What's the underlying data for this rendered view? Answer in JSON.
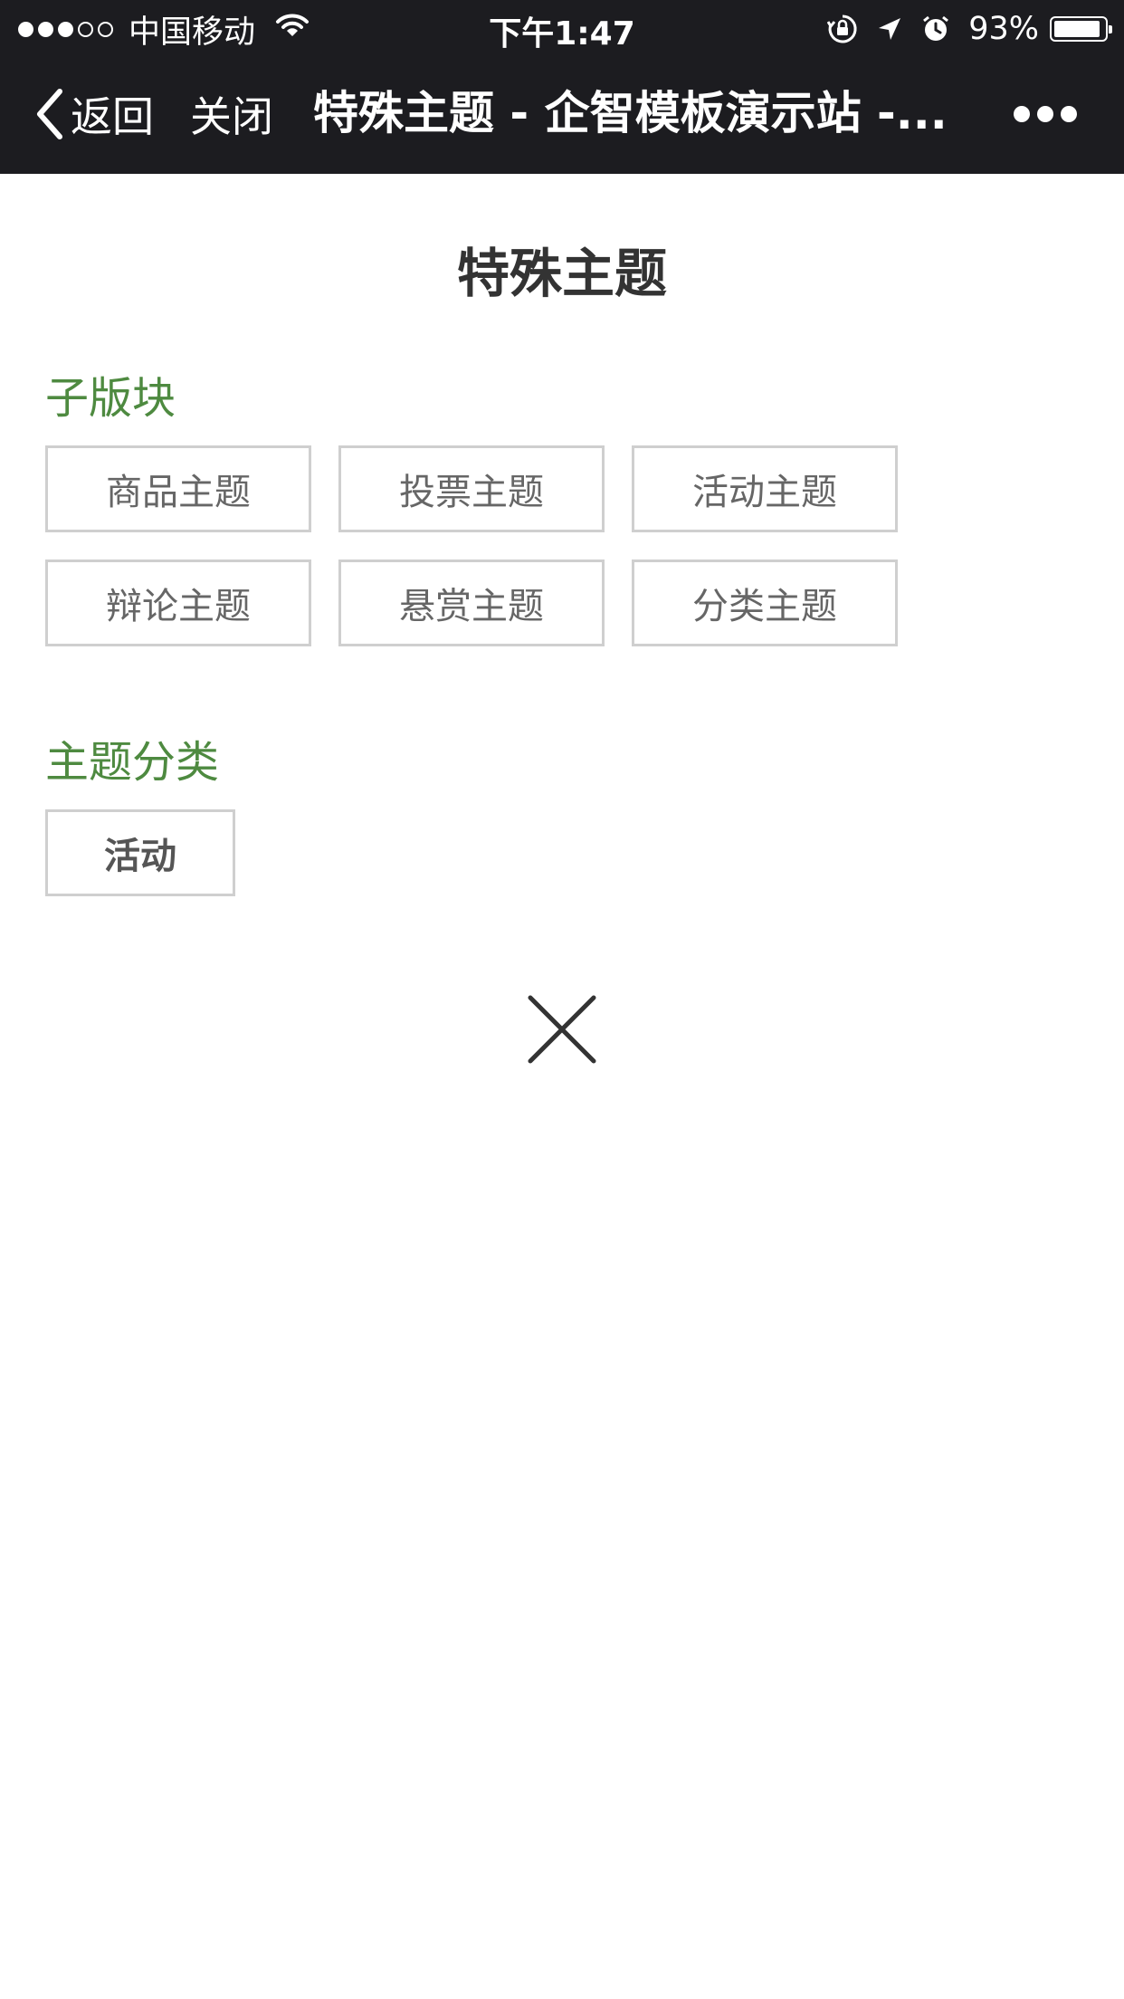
{
  "status_bar": {
    "carrier": "中国移动",
    "time": "下午1:47",
    "battery_percent": "93%",
    "battery_level": 0.93,
    "signal_strength": 3,
    "signal_total": 5
  },
  "nav": {
    "back_label": "返回",
    "close_label": "关闭",
    "title": "特殊主题 - 企智模板演示站 -..."
  },
  "page": {
    "title": "特殊主题"
  },
  "subforums": {
    "heading": "子版块",
    "items": [
      {
        "label": "商品主题"
      },
      {
        "label": "投票主题"
      },
      {
        "label": "活动主题"
      },
      {
        "label": "辩论主题"
      },
      {
        "label": "悬赏主题"
      },
      {
        "label": "分类主题"
      }
    ]
  },
  "categories": {
    "heading": "主题分类",
    "items": [
      {
        "label": "活动"
      }
    ]
  },
  "colors": {
    "nav_background": "#1c1c20",
    "section_heading": "#4e8a40",
    "tag_border": "#cfcfcf",
    "tag_text": "#666666"
  },
  "icons": {
    "back": "chevron-left-icon",
    "more": "more-dots-icon",
    "close_panel": "close-icon",
    "wifi": "wifi-icon",
    "orientation_lock": "orientation-lock-icon",
    "location": "location-arrow-icon",
    "alarm": "alarm-icon",
    "battery": "battery-icon"
  }
}
